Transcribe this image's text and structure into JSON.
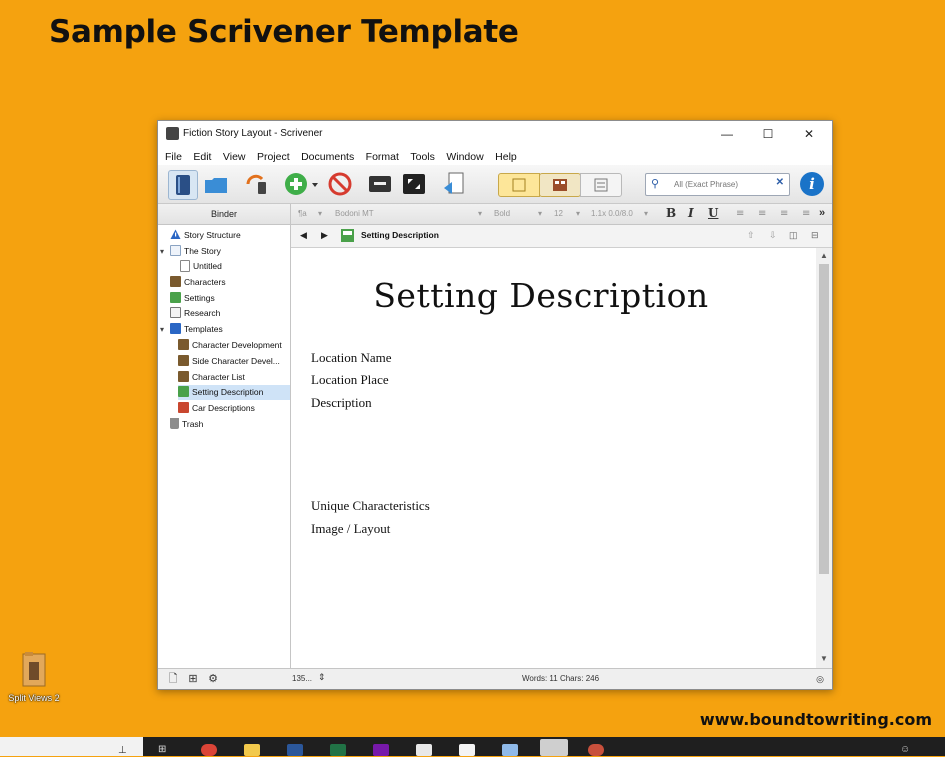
{
  "heading": "Sample Scrivener Template",
  "site_url": "www.boundtowriting.com",
  "desktop_icon": {
    "label": "Split Views 2"
  },
  "window": {
    "title": "Fiction Story Layout - Scrivener",
    "controls": {
      "minimize": "—",
      "maximize": "☐",
      "close": "✕"
    }
  },
  "menu": [
    "File",
    "Edit",
    "View",
    "Project",
    "Documents",
    "Format",
    "Tools",
    "Window",
    "Help"
  ],
  "search": {
    "placeholder": "All (Exact Phrase)",
    "clear": "✕"
  },
  "formatbar": {
    "binder_label": "Binder",
    "style": "¶a",
    "font": "Bodoni MT",
    "weight": "Bold",
    "size": "12",
    "spacing": "1.1x 0.0/8.0",
    "bold": "B",
    "italic": "I",
    "underline": "U",
    "more": "»"
  },
  "binder": {
    "items": [
      {
        "label": "Story Structure"
      },
      {
        "label": "The Story"
      },
      {
        "label": "Untitled"
      },
      {
        "label": "Characters"
      },
      {
        "label": "Settings"
      },
      {
        "label": "Research"
      },
      {
        "label": "Templates"
      },
      {
        "label": "Character Development"
      },
      {
        "label": "Side Character Devel..."
      },
      {
        "label": "Character List"
      },
      {
        "label": "Setting Description"
      },
      {
        "label": "Car Descriptions"
      },
      {
        "label": "Trash"
      }
    ]
  },
  "editor": {
    "header_title": "Setting Description",
    "heading": "Setting Description",
    "lines": [
      "Location Name",
      "Location Place",
      "Description",
      "Unique Characteristics",
      "Image / Layout"
    ]
  },
  "footer": {
    "zoom": "135...",
    "counts": "Words: 11    Chars: 246"
  },
  "colors": {
    "background": "#f5a20f",
    "selection": "#cfe3f7",
    "info_blue": "#1a73c8"
  }
}
